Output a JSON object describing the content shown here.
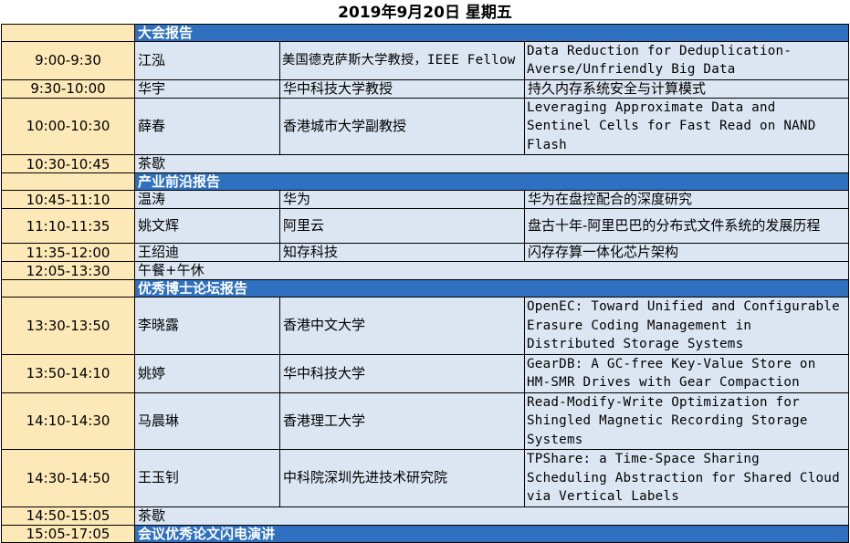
{
  "title": "2019年9月20日  星期五",
  "rows": [
    {
      "kind": "section",
      "time": "",
      "label": "大会报告"
    },
    {
      "kind": "talk",
      "time": "9:00-9:30",
      "speaker": "江泓",
      "affiliation": "美国德克萨斯大学教授，IEEE Fellow",
      "topic": "Data Reduction for Deduplication-Averse/Unfriendly Big Data"
    },
    {
      "kind": "talk",
      "time": "9:30-10:00",
      "speaker": "华宇",
      "affiliation": "华中科技大学教授",
      "topic": "持久内存系统安全与计算模式"
    },
    {
      "kind": "talk",
      "time": "10:00-10:30",
      "speaker": "薛春",
      "affiliation": "香港城市大学副教授",
      "topic": "Leveraging Approximate Data and Sentinel Cells for Fast Read on NAND Flash"
    },
    {
      "kind": "break",
      "time": "10:30-10:45",
      "label": "茶歇"
    },
    {
      "kind": "section",
      "time": "",
      "label": "产业前沿报告"
    },
    {
      "kind": "talk",
      "time": "10:45-11:10",
      "speaker": "温涛",
      "affiliation": "华为",
      "topic": "华为在盘控配合的深度研究"
    },
    {
      "kind": "talk",
      "time": "11:10-11:35",
      "speaker": "姚文辉",
      "affiliation": "阿里云",
      "topic": "盘古十年-阿里巴巴的分布式文件系统的发展历程"
    },
    {
      "kind": "talk",
      "time": "11:35-12:00",
      "speaker": "王绍迪",
      "affiliation": "知存科技",
      "topic": "闪存存算一体化芯片架构"
    },
    {
      "kind": "break",
      "time": "12:05-13:30",
      "label": "午餐+午休"
    },
    {
      "kind": "section",
      "time": "",
      "label": "优秀博士论坛报告"
    },
    {
      "kind": "talk",
      "time": "13:30-13:50",
      "speaker": "李晓露",
      "affiliation": "香港中文大学",
      "topic": "OpenEC: Toward Unified and Configurable Erasure Coding Management in Distributed Storage Systems"
    },
    {
      "kind": "talk",
      "time": "13:50-14:10",
      "speaker": "姚婷",
      "affiliation": "华中科技大学",
      "topic": "GearDB: A GC-free Key-Value Store on HM-SMR Drives with Gear Compaction"
    },
    {
      "kind": "talk",
      "time": "14:10-14:30",
      "speaker": "马晨琳",
      "affiliation": "香港理工大学",
      "topic": "Read-Modify-Write Optimization for Shingled Magnetic Recording Storage Systems"
    },
    {
      "kind": "talk",
      "time": "14:30-14:50",
      "speaker": "王玉钊",
      "affiliation": "中科院深圳先进技术研究院",
      "topic": "TPShare: a Time-Space Sharing Scheduling Abstraction for Shared Cloud via Vertical Labels"
    },
    {
      "kind": "break",
      "time": "14:50-15:05",
      "label": "茶歇"
    },
    {
      "kind": "section",
      "time": "15:05-17:05",
      "label": "会议优秀论文闪电演讲"
    }
  ]
}
